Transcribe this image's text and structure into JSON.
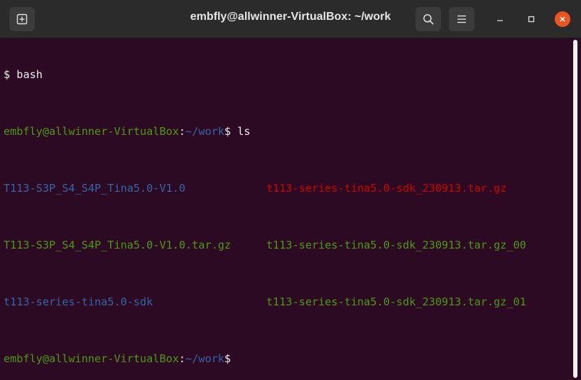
{
  "window": {
    "title": "embfly@allwinner-VirtualBox: ~/work",
    "accent_color": "#e95420",
    "background_color": "#2c0a23"
  },
  "header": {
    "new_tab_icon": "new-tab-icon",
    "search_icon": "search-icon",
    "menu_icon": "hamburger-menu-icon",
    "minimize_icon": "minimize-icon",
    "maximize_icon": "maximize-icon",
    "close_icon": "close-icon"
  },
  "terminal": {
    "line1": {
      "prompt": "$",
      "command": " bash"
    },
    "line2": {
      "user_host": "embfly@allwinner-VirtualBox",
      "sep": ":",
      "path": "~/work",
      "dollar": "$",
      "command": " ls"
    },
    "ls_output": [
      {
        "left": "T113-S3P_S4_S4P_Tina5.0-V1.0",
        "right": "t113-series-tina5.0-sdk_230913.tar.gz"
      },
      {
        "left": "T113-S3P_S4_S4P_Tina5.0-V1.0.tar.gz",
        "right": "t113-series-tina5.0-sdk_230913.tar.gz_00"
      },
      {
        "left": "t113-series-tina5.0-sdk",
        "right": "t113-series-tina5.0-sdk_230913.tar.gz_01"
      }
    ],
    "line6": {
      "user_host": "embfly@allwinner-VirtualBox",
      "sep": ":",
      "path": "~/work",
      "dollar": "$"
    },
    "colors": {
      "prompt_user": "#4e9a06",
      "prompt_path": "#3465a4",
      "directory": "#3465a4",
      "archive": "#cc0000",
      "executable": "#4e9a06",
      "text": "#eeeeec"
    }
  }
}
